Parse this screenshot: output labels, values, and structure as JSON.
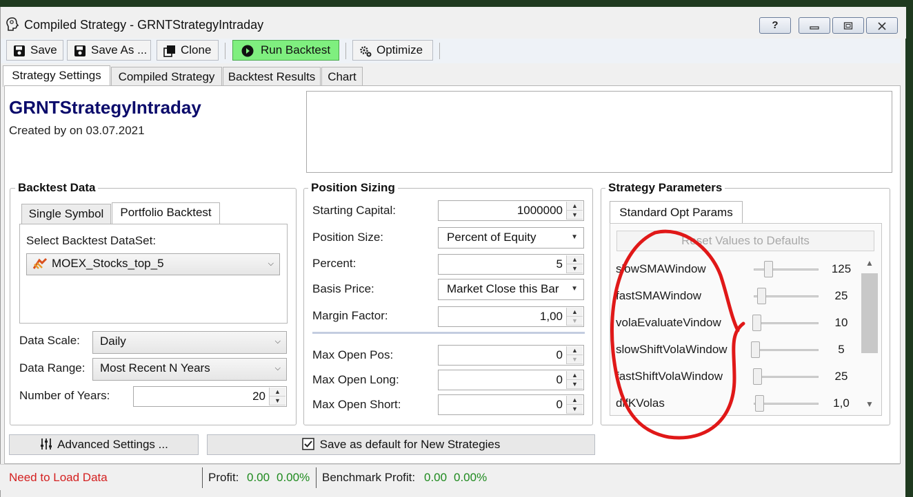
{
  "window": {
    "title": "Compiled Strategy - GRNTStrategyIntraday",
    "help_label": "?"
  },
  "toolbar": {
    "save": "Save",
    "save_as": "Save As ...",
    "clone": "Clone",
    "run_backtest": "Run Backtest",
    "optimize": "Optimize"
  },
  "tabs": [
    "Strategy Settings",
    "Compiled Strategy",
    "Backtest Results",
    "Chart"
  ],
  "strategy": {
    "name": "GRNTStrategyIntraday",
    "created": "Created by  on 03.07.2021"
  },
  "backtest_data": {
    "title": "Backtest Data",
    "tabs": [
      "Single Symbol",
      "Portfolio Backtest"
    ],
    "select_label": "Select Backtest DataSet:",
    "dataset": "MOEX_Stocks_top_5",
    "data_scale_label": "Data Scale:",
    "data_scale": "Daily",
    "data_range_label": "Data Range:",
    "data_range": "Most Recent N Years",
    "years_label": "Number of Years:",
    "years": "20"
  },
  "position_sizing": {
    "title": "Position Sizing",
    "starting_capital_label": "Starting Capital:",
    "starting_capital": "1000000",
    "position_size_label": "Position Size:",
    "position_size": "Percent of Equity",
    "percent_label": "Percent:",
    "percent": "5",
    "basis_price_label": "Basis Price:",
    "basis_price": "Market Close this Bar",
    "margin_factor_label": "Margin Factor:",
    "margin_factor": "1,00",
    "max_open_pos_label": "Max Open Pos:",
    "max_open_pos": "0",
    "max_open_long_label": "Max Open Long:",
    "max_open_long": "0",
    "max_open_short_label": "Max Open Short:",
    "max_open_short": "0"
  },
  "strategy_parameters": {
    "title": "Strategy Parameters",
    "tab": "Standard Opt Params",
    "reset_label": "Reset Values to Defaults",
    "params": [
      {
        "name": "slowSMAWindow",
        "value": "125",
        "level": 0.2
      },
      {
        "name": "fastSMAWindow",
        "value": "25",
        "level": 0.1
      },
      {
        "name": "volaEvaluateVindow",
        "value": "10",
        "level": 0.02
      },
      {
        "name": "slowShiftVolaWindow",
        "value": "5",
        "level": 0.0
      },
      {
        "name": "fastShiftVolaWindow",
        "value": "25",
        "level": 0.03
      },
      {
        "name": "difKVolas",
        "value": "1,0",
        "level": 0.06
      }
    ]
  },
  "bottom": {
    "advanced": "Advanced Settings ...",
    "save_default": "Save as default for New Strategies"
  },
  "status": {
    "message": "Need to Load Data",
    "profit_label": "Profit:",
    "profit_value": "0.00",
    "profit_pct": "0.00%",
    "benchmark_label": "Benchmark Profit:",
    "benchmark_value": "0.00",
    "benchmark_pct": "0.00%"
  },
  "colors": {
    "accent_title": "#0b0b6b",
    "run_button": "#7fef7f",
    "error_text": "#d42020",
    "profit_text": "#1e8a1e",
    "annotation": "#e01818"
  }
}
